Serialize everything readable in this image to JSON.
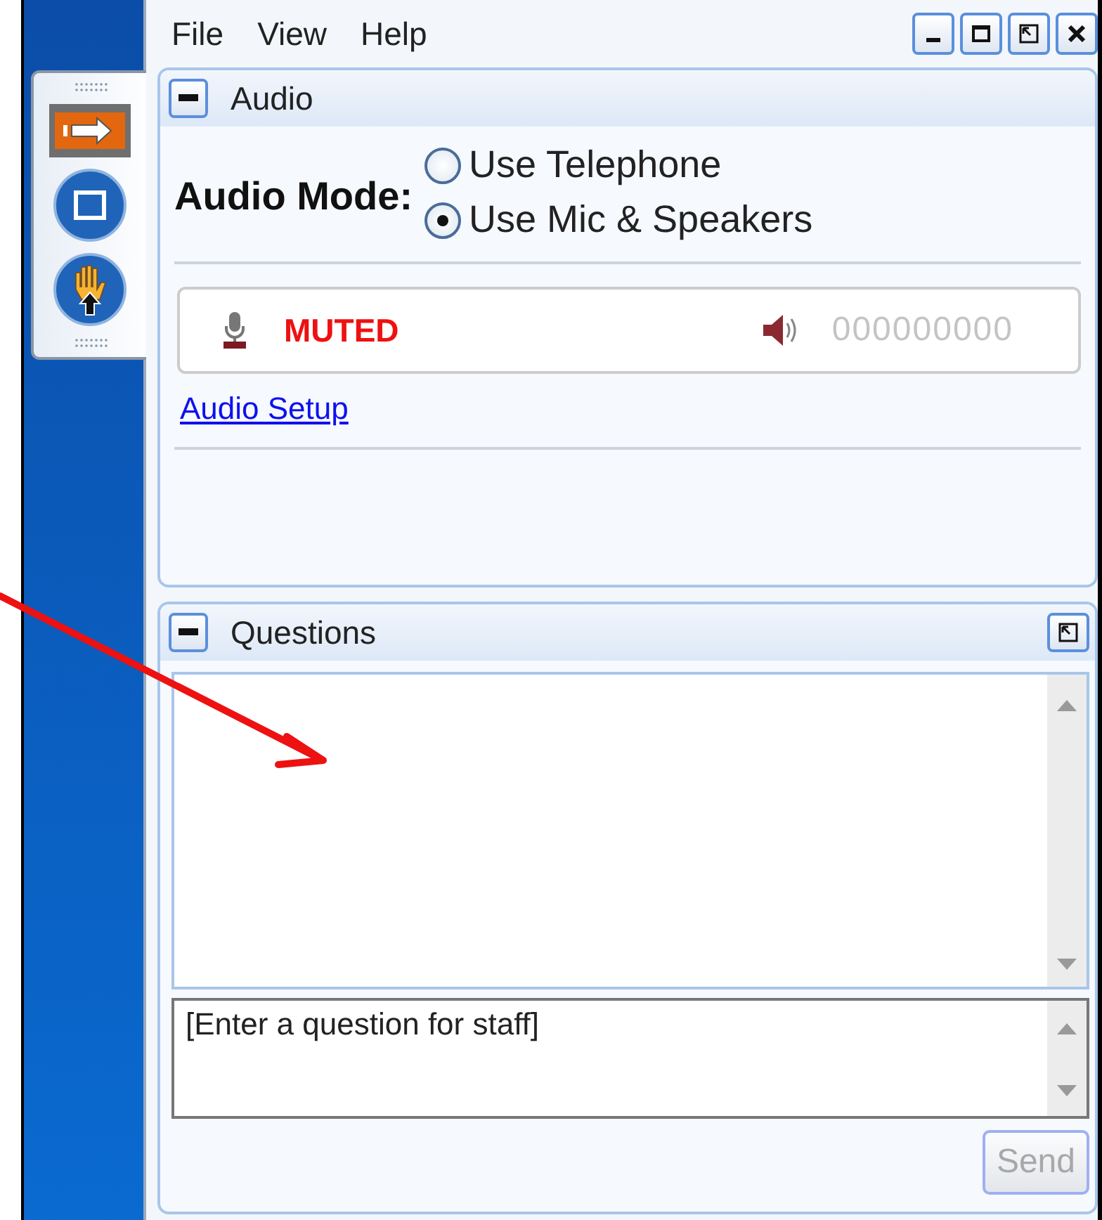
{
  "menu": [
    "File",
    "View",
    "Help"
  ],
  "audio_panel": {
    "title": "Audio",
    "mode_label": "Audio Mode:",
    "options": [
      {
        "label": "Use Telephone",
        "selected": false
      },
      {
        "label": "Use Mic & Speakers",
        "selected": true
      }
    ],
    "mic_status": "MUTED",
    "speaker_level": "000000000",
    "setup_link": "Audio Setup"
  },
  "questions_panel": {
    "title": "Questions",
    "input": {
      "placeholder": "[Enter a question for staff]"
    },
    "send_button": {
      "label": "Send",
      "disabled": true
    }
  }
}
